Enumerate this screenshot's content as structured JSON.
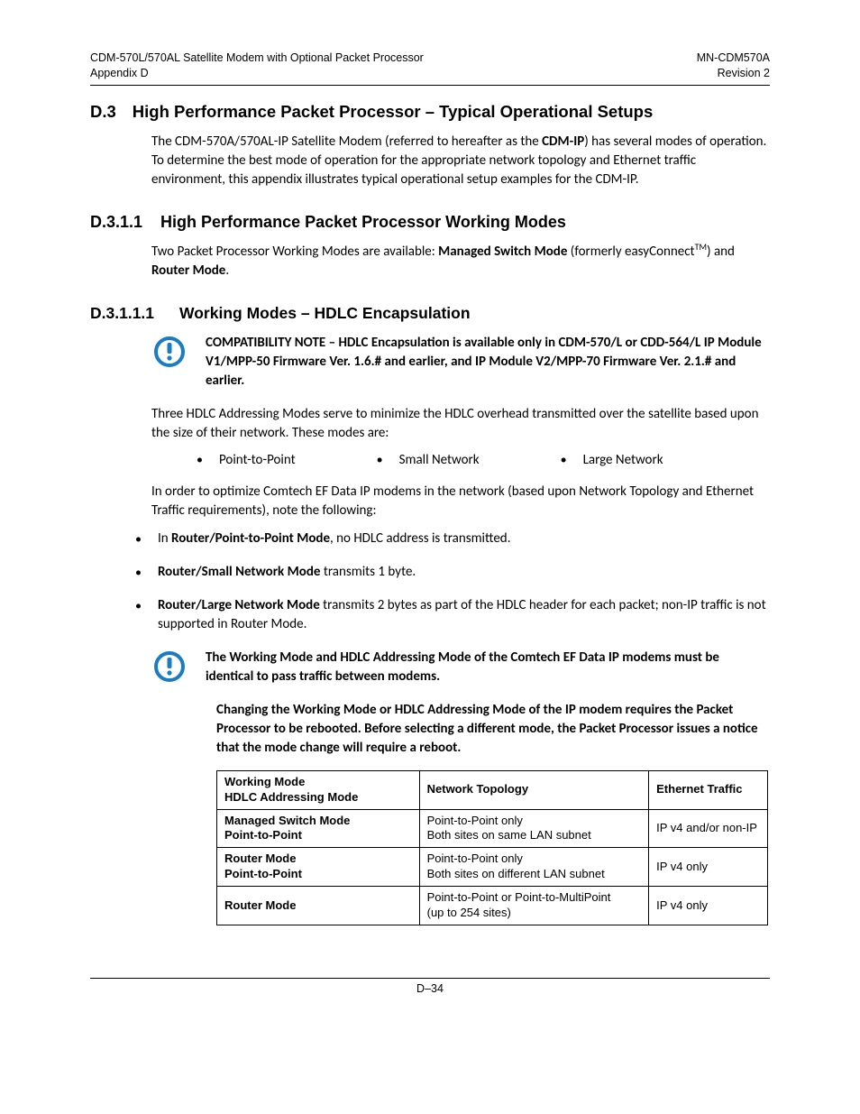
{
  "header": {
    "left_line1": "CDM-570L/570AL Satellite Modem with Optional Packet Processor",
    "left_line2": "Appendix D",
    "right_line1": "MN-CDM570A",
    "right_line2": "Revision 2"
  },
  "sections": {
    "d3_num": "D.3",
    "d3_title": "High Performance Packet Processor – Typical Operational Setups",
    "d3_intro_a": "The CDM-570A/570AL-IP Satellite Modem (referred to hereafter as the ",
    "d3_intro_bold": "CDM-IP",
    "d3_intro_b": ") has several modes of operation. To determine the best mode of operation for the appropriate network topology and Ethernet traffic environment, this appendix illustrates typical operational setup examples for the CDM-IP.",
    "d311_num": "D.3.1.1",
    "d311_title": "High Performance Packet Processor Working Modes",
    "d311_p_a": "Two Packet Processor Working Modes are available: ",
    "d311_bold1": "Managed Switch Mode",
    "d311_p_b": " (formerly easyConnect",
    "d311_tm": "TM",
    "d311_p_c": ") and ",
    "d311_bold2": "Router Mode",
    "d311_p_d": ".",
    "d3111_num": "D.3.1.1.1",
    "d3111_title": "Working Modes – HDLC Encapsulation",
    "compat_note": "COMPATIBILITY NOTE – HDLC Encapsulation is available only in CDM-570/L or CDD-564/L IP Module V1/MPP-50 Firmware Ver. 1.6.# and earlier, and IP Module V2/MPP-70 Firmware Ver. 2.1.# and earlier.",
    "hdlc_intro": "Three HDLC Addressing Modes serve to minimize the HDLC overhead transmitted over the satellite based upon the size of their network. These modes are:",
    "hdlc_modes": [
      "Point-to-Point",
      "Small Network",
      "Large Network"
    ],
    "optimize_intro": "In order to optimize Comtech EF Data IP modems in the network (based upon Network Topology and Ethernet Traffic requirements), note the following:",
    "opts": [
      {
        "bold": "Router/Point-to-Point Mode",
        "rest_a": "In ",
        "rest_b": ", no HDLC address is transmitted."
      },
      {
        "bold": "Router/Small Network Mode",
        "rest_a": "",
        "rest_b": " transmits 1 byte."
      },
      {
        "bold": "Router/Large Network Mode",
        "rest_a": "",
        "rest_b": " transmits 2 bytes as part of the HDLC header for each packet; non-IP traffic is not supported in Router Mode."
      }
    ],
    "warn1": "The Working Mode and HDLC Addressing Mode of the Comtech EF Data IP modems must be identical to pass traffic between modems.",
    "warn2": "Changing the Working Mode or HDLC Addressing Mode of the IP modem requires the Packet Processor to be rebooted. Before selecting a different mode, the Packet Processor issues a notice that the mode change will require a reboot."
  },
  "table": {
    "headers": [
      "Working Mode\nHDLC Addressing Mode",
      "Network Topology",
      "Ethernet Traffic"
    ],
    "rows": [
      [
        "Managed Switch Mode\nPoint-to-Point",
        "Point-to-Point only\nBoth sites on same LAN subnet",
        "IP v4 and/or non-IP"
      ],
      [
        "Router Mode\nPoint-to-Point",
        "Point-to-Point only\nBoth sites on different LAN subnet",
        "IP v4 only"
      ],
      [
        "Router Mode",
        "Point-to-Point or Point-to-MultiPoint\n(up to 254 sites)",
        "IP v4 only"
      ]
    ]
  },
  "footer": {
    "page": "D–34"
  }
}
